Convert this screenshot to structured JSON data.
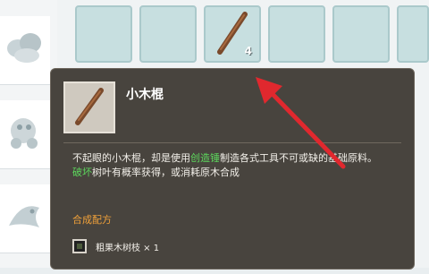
{
  "inventory": {
    "slot_stick_count": "4"
  },
  "tooltip": {
    "title": "小木棍",
    "desc_part1": "不起眼的小木棍，却是使用",
    "desc_highlight1": "创造锤",
    "desc_part2": "制造各式工具不可或缺的基础原料。",
    "desc_highlight2": "破坏",
    "desc_part3": "树叶有概率获得，或消耗原木合成",
    "recipe_title": "合成配方",
    "recipe_item": "粗果木树枝 × 1"
  },
  "colors": {
    "highlight_green": "#5cd65c",
    "recipe_orange": "#f0a13a",
    "arrow_red": "#e0282e"
  }
}
